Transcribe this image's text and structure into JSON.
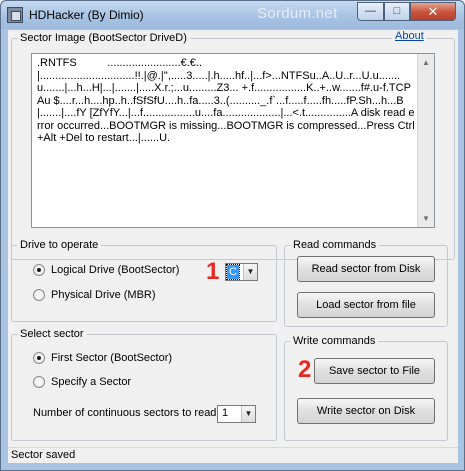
{
  "window": {
    "title": "HDHacker (By Dimio)",
    "watermark": "Sordum.net"
  },
  "sector_image": {
    "legend": "Sector Image (BootSector DriveD)",
    "about_link": "About",
    "content": ".RNTFS          ........................€.€..\n|...............................!!.|@.|'',.....3.....|.h.....hf..|...f>...NTFSu..A..U..r...U.u.......u.......|...h...H|...|.......|.....X.r.;...u.........Z3... +.f.................K..+..w.......f#.u-f.TCPAu $....r...h....hp..h..fSfSfU....h..fa.....3..(.........._.f`...f.....f.....fh.....fP.Sh...h...B|.......|....fY [ZfYfY...|...f.................u....fa...................|...<.t...............A disk read error occurred...BOOTMGR is missing...BOOTMGR is compressed...Press Ctrl+Alt +Del to restart...|......U."
  },
  "drive_to_operate": {
    "legend": "Drive to operate",
    "options": [
      "Logical Drive (BootSector)",
      "Physical Drive (MBR)"
    ],
    "selected_index": 0,
    "drive_letter": "C"
  },
  "read_commands": {
    "legend": "Read commands",
    "read_button": "Read sector from Disk",
    "load_button": "Load sector from file"
  },
  "select_sector": {
    "legend": "Select sector",
    "options": [
      "First Sector (BootSector)",
      "Specify a Sector"
    ],
    "selected_index": 0,
    "count_label": "Number of continuous sectors to read",
    "count_value": "1"
  },
  "write_commands": {
    "legend": "Write commands",
    "save_button": "Save sector to File",
    "write_button": "Write sector on Disk"
  },
  "annotations": {
    "marker_1": "1",
    "marker_2": "2"
  },
  "status": {
    "text": "Sector saved"
  },
  "colors": {
    "marker": "#e8271e",
    "link": "#0645ad",
    "selection": "#3399ff"
  }
}
